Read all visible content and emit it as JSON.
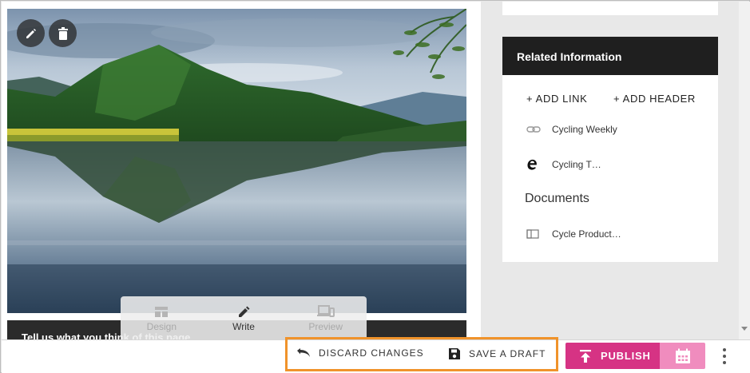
{
  "editor": {
    "footer_text": "Tell us what you think of this page",
    "modes": [
      {
        "label": "Design",
        "icon": "grid-icon",
        "active": false
      },
      {
        "label": "Write",
        "icon": "pencil-icon",
        "active": true
      },
      {
        "label": "Preview",
        "icon": "devices-icon",
        "active": false
      }
    ]
  },
  "related": {
    "title": "Related Information",
    "add_link": "+ ADD LINK",
    "add_header": "+ ADD HEADER",
    "links": [
      {
        "label": "Cycling Weekly",
        "icon": "link-icon"
      },
      {
        "label": "Cycling T…",
        "icon": "edge-browser-icon"
      }
    ],
    "documents_title": "Documents",
    "documents": [
      {
        "label": "Cycle Product…",
        "icon": "document-layout-icon"
      }
    ]
  },
  "actions": {
    "discard": "DISCARD CHANGES",
    "save_draft": "SAVE A DRAFT",
    "publish": "PUBLISH"
  },
  "colors": {
    "publish": "#d63384",
    "schedule": "#f08cbe",
    "highlight": "#f0932b",
    "header_dark": "#1f1f1f"
  }
}
